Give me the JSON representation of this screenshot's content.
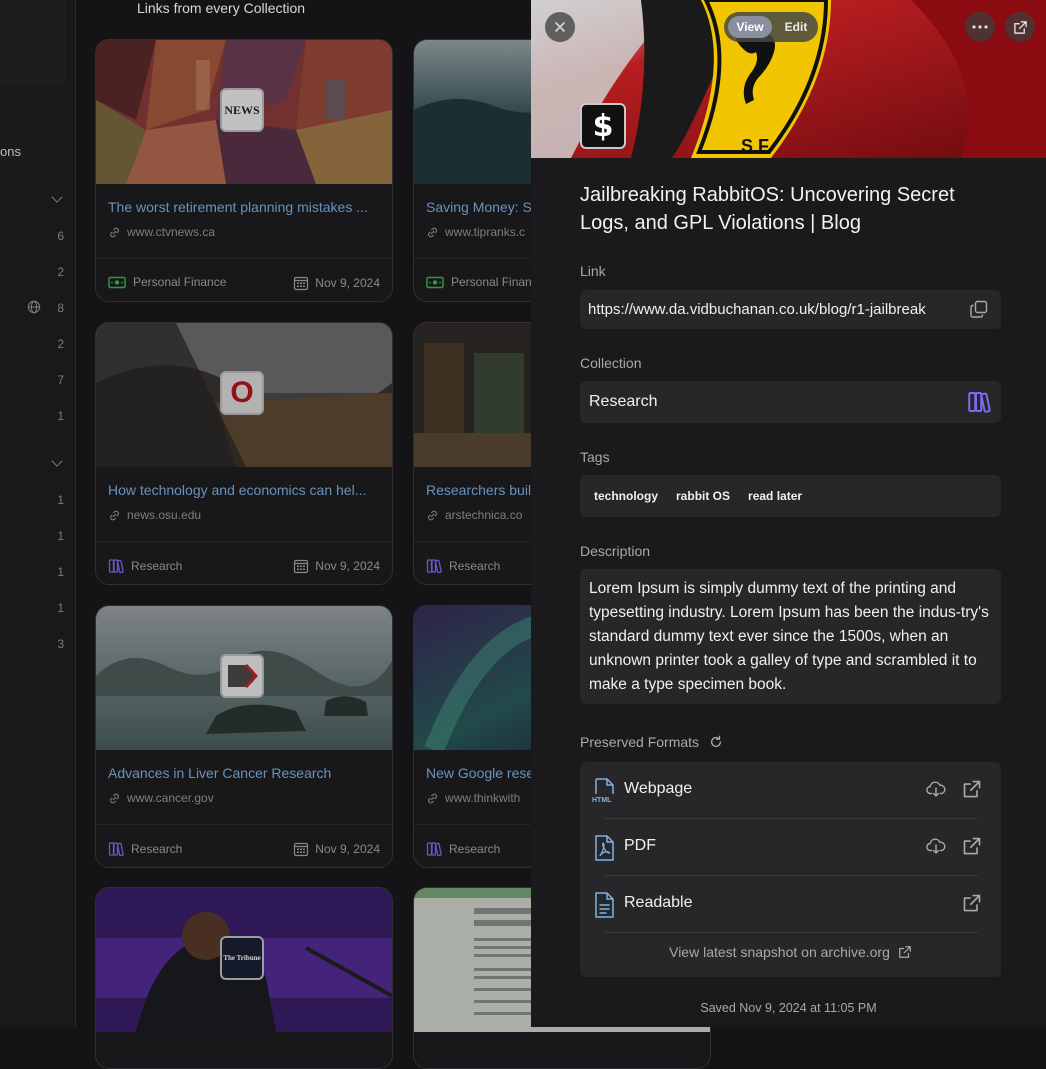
{
  "sidebar": {
    "section_label": "ons",
    "counts": [
      "6",
      "2",
      "8",
      "2",
      "7",
      "1",
      "1",
      "1",
      "1",
      "1",
      "3"
    ]
  },
  "main": {
    "heading": "Links from every Collection",
    "cards": [
      {
        "title": "The worst retirement planning mistakes ...",
        "url": "www.ctvnews.ca",
        "collection": "Personal Finance",
        "date": "Nov 9, 2024",
        "favicon_text": "NEWS"
      },
      {
        "title": "Saving Money: S",
        "url": "www.tipranks.c",
        "collection": "Personal Finan",
        "date": ""
      },
      {
        "title": "How technology and economics can hel...",
        "url": "news.osu.edu",
        "collection": "Research",
        "date": "Nov 9, 2024",
        "favicon_text": "O"
      },
      {
        "title": "Researchers buil",
        "url": "arstechnica.co",
        "collection": "Research",
        "date": ""
      },
      {
        "title": "Advances in Liver Cancer Research",
        "url": "www.cancer.gov",
        "collection": "Research",
        "date": "Nov 9, 2024"
      },
      {
        "title": "New Google rese",
        "url": "www.thinkwith",
        "collection": "Research",
        "date": ""
      },
      {
        "favicon_text": "The Tribune"
      }
    ]
  },
  "drawer": {
    "close_icon": "close-icon",
    "view_label": "View",
    "edit_label": "Edit",
    "title": "Jailbreaking RabbitOS: Uncovering Secret Logs, and GPL Violations | Blog",
    "favicon_glyph": "$",
    "link_label": "Link",
    "link_value": "https://www.da.vidbuchanan.co.uk/blog/r1-jailbreak",
    "collection_label": "Collection",
    "collection_value": "Research",
    "tags_label": "Tags",
    "tags": [
      "technology",
      "rabbit OS",
      "read later"
    ],
    "description_label": "Description",
    "description": "Lorem Ipsum is simply dummy text of the printing and typesetting industry. Lorem Ipsum has been the indus-try's standard dummy text ever since the 1500s, when an unknown printer took a galley of type and scrambled it to make a type specimen book.",
    "preserved_label": "Preserved Formats",
    "formats": [
      {
        "label": "Webpage",
        "icon_text": "HTML"
      },
      {
        "label": "PDF"
      },
      {
        "label": "Readable"
      }
    ],
    "archive_link": "View latest snapshot on archive.org",
    "saved": "Saved Nov 9, 2024 at 11:05 PM"
  },
  "colors": {
    "accent_blue": "#7fb3e6",
    "finance_green": "#3fb950",
    "research_purple": "#7c6cf5"
  }
}
